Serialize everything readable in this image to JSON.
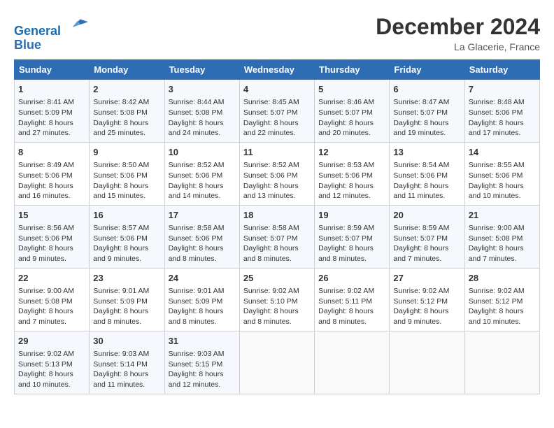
{
  "header": {
    "logo_line1": "General",
    "logo_line2": "Blue",
    "month_year": "December 2024",
    "location": "La Glacerie, France"
  },
  "days_of_week": [
    "Sunday",
    "Monday",
    "Tuesday",
    "Wednesday",
    "Thursday",
    "Friday",
    "Saturday"
  ],
  "weeks": [
    [
      {
        "day": "1",
        "sunrise": "Sunrise: 8:41 AM",
        "sunset": "Sunset: 5:09 PM",
        "daylight": "Daylight: 8 hours and 27 minutes."
      },
      {
        "day": "2",
        "sunrise": "Sunrise: 8:42 AM",
        "sunset": "Sunset: 5:08 PM",
        "daylight": "Daylight: 8 hours and 25 minutes."
      },
      {
        "day": "3",
        "sunrise": "Sunrise: 8:44 AM",
        "sunset": "Sunset: 5:08 PM",
        "daylight": "Daylight: 8 hours and 24 minutes."
      },
      {
        "day": "4",
        "sunrise": "Sunrise: 8:45 AM",
        "sunset": "Sunset: 5:07 PM",
        "daylight": "Daylight: 8 hours and 22 minutes."
      },
      {
        "day": "5",
        "sunrise": "Sunrise: 8:46 AM",
        "sunset": "Sunset: 5:07 PM",
        "daylight": "Daylight: 8 hours and 20 minutes."
      },
      {
        "day": "6",
        "sunrise": "Sunrise: 8:47 AM",
        "sunset": "Sunset: 5:07 PM",
        "daylight": "Daylight: 8 hours and 19 minutes."
      },
      {
        "day": "7",
        "sunrise": "Sunrise: 8:48 AM",
        "sunset": "Sunset: 5:06 PM",
        "daylight": "Daylight: 8 hours and 17 minutes."
      }
    ],
    [
      {
        "day": "8",
        "sunrise": "Sunrise: 8:49 AM",
        "sunset": "Sunset: 5:06 PM",
        "daylight": "Daylight: 8 hours and 16 minutes."
      },
      {
        "day": "9",
        "sunrise": "Sunrise: 8:50 AM",
        "sunset": "Sunset: 5:06 PM",
        "daylight": "Daylight: 8 hours and 15 minutes."
      },
      {
        "day": "10",
        "sunrise": "Sunrise: 8:52 AM",
        "sunset": "Sunset: 5:06 PM",
        "daylight": "Daylight: 8 hours and 14 minutes."
      },
      {
        "day": "11",
        "sunrise": "Sunrise: 8:52 AM",
        "sunset": "Sunset: 5:06 PM",
        "daylight": "Daylight: 8 hours and 13 minutes."
      },
      {
        "day": "12",
        "sunrise": "Sunrise: 8:53 AM",
        "sunset": "Sunset: 5:06 PM",
        "daylight": "Daylight: 8 hours and 12 minutes."
      },
      {
        "day": "13",
        "sunrise": "Sunrise: 8:54 AM",
        "sunset": "Sunset: 5:06 PM",
        "daylight": "Daylight: 8 hours and 11 minutes."
      },
      {
        "day": "14",
        "sunrise": "Sunrise: 8:55 AM",
        "sunset": "Sunset: 5:06 PM",
        "daylight": "Daylight: 8 hours and 10 minutes."
      }
    ],
    [
      {
        "day": "15",
        "sunrise": "Sunrise: 8:56 AM",
        "sunset": "Sunset: 5:06 PM",
        "daylight": "Daylight: 8 hours and 9 minutes."
      },
      {
        "day": "16",
        "sunrise": "Sunrise: 8:57 AM",
        "sunset": "Sunset: 5:06 PM",
        "daylight": "Daylight: 8 hours and 9 minutes."
      },
      {
        "day": "17",
        "sunrise": "Sunrise: 8:58 AM",
        "sunset": "Sunset: 5:06 PM",
        "daylight": "Daylight: 8 hours and 8 minutes."
      },
      {
        "day": "18",
        "sunrise": "Sunrise: 8:58 AM",
        "sunset": "Sunset: 5:07 PM",
        "daylight": "Daylight: 8 hours and 8 minutes."
      },
      {
        "day": "19",
        "sunrise": "Sunrise: 8:59 AM",
        "sunset": "Sunset: 5:07 PM",
        "daylight": "Daylight: 8 hours and 8 minutes."
      },
      {
        "day": "20",
        "sunrise": "Sunrise: 8:59 AM",
        "sunset": "Sunset: 5:07 PM",
        "daylight": "Daylight: 8 hours and 7 minutes."
      },
      {
        "day": "21",
        "sunrise": "Sunrise: 9:00 AM",
        "sunset": "Sunset: 5:08 PM",
        "daylight": "Daylight: 8 hours and 7 minutes."
      }
    ],
    [
      {
        "day": "22",
        "sunrise": "Sunrise: 9:00 AM",
        "sunset": "Sunset: 5:08 PM",
        "daylight": "Daylight: 8 hours and 7 minutes."
      },
      {
        "day": "23",
        "sunrise": "Sunrise: 9:01 AM",
        "sunset": "Sunset: 5:09 PM",
        "daylight": "Daylight: 8 hours and 8 minutes."
      },
      {
        "day": "24",
        "sunrise": "Sunrise: 9:01 AM",
        "sunset": "Sunset: 5:09 PM",
        "daylight": "Daylight: 8 hours and 8 minutes."
      },
      {
        "day": "25",
        "sunrise": "Sunrise: 9:02 AM",
        "sunset": "Sunset: 5:10 PM",
        "daylight": "Daylight: 8 hours and 8 minutes."
      },
      {
        "day": "26",
        "sunrise": "Sunrise: 9:02 AM",
        "sunset": "Sunset: 5:11 PM",
        "daylight": "Daylight: 8 hours and 8 minutes."
      },
      {
        "day": "27",
        "sunrise": "Sunrise: 9:02 AM",
        "sunset": "Sunset: 5:12 PM",
        "daylight": "Daylight: 8 hours and 9 minutes."
      },
      {
        "day": "28",
        "sunrise": "Sunrise: 9:02 AM",
        "sunset": "Sunset: 5:12 PM",
        "daylight": "Daylight: 8 hours and 10 minutes."
      }
    ],
    [
      {
        "day": "29",
        "sunrise": "Sunrise: 9:02 AM",
        "sunset": "Sunset: 5:13 PM",
        "daylight": "Daylight: 8 hours and 10 minutes."
      },
      {
        "day": "30",
        "sunrise": "Sunrise: 9:03 AM",
        "sunset": "Sunset: 5:14 PM",
        "daylight": "Daylight: 8 hours and 11 minutes."
      },
      {
        "day": "31",
        "sunrise": "Sunrise: 9:03 AM",
        "sunset": "Sunset: 5:15 PM",
        "daylight": "Daylight: 8 hours and 12 minutes."
      },
      null,
      null,
      null,
      null
    ]
  ]
}
